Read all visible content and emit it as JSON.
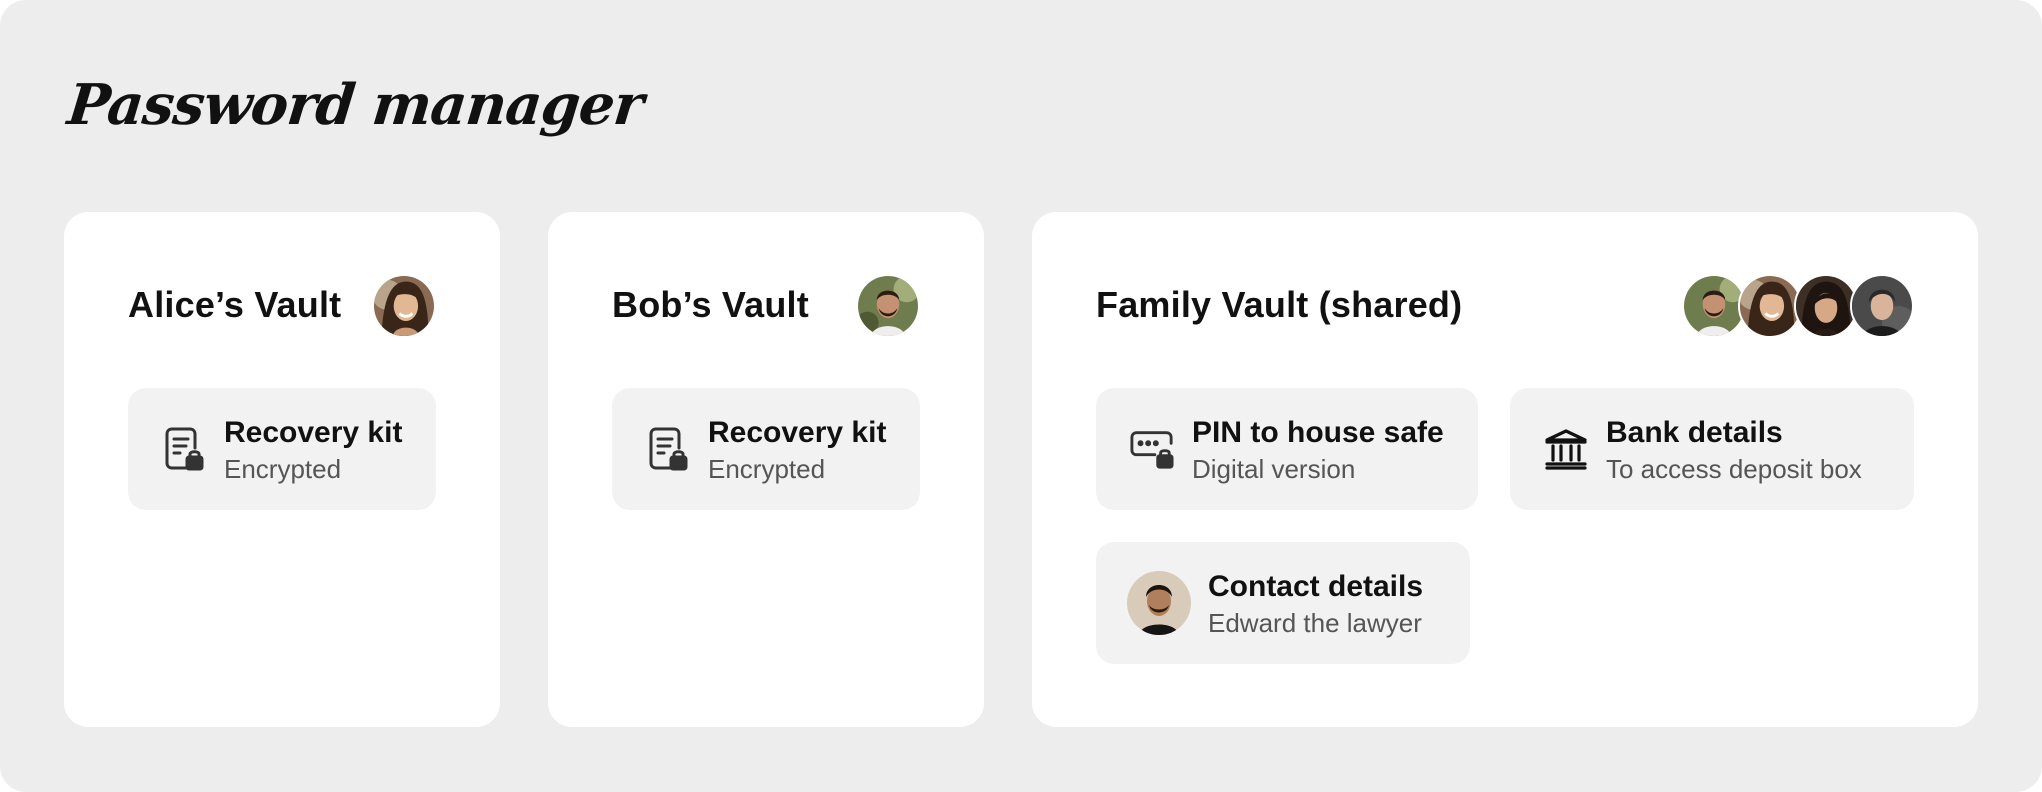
{
  "app": {
    "title": "Password manager"
  },
  "vaults": [
    {
      "name": "Alice’s Vault",
      "members": [
        "alice"
      ],
      "items": [
        {
          "title": "Recovery kit",
          "subtitle": "Encrypted",
          "icon": "document-lock-icon"
        }
      ]
    },
    {
      "name": "Bob’s Vault",
      "members": [
        "bob"
      ],
      "items": [
        {
          "title": "Recovery kit",
          "subtitle": "Encrypted",
          "icon": "document-lock-icon"
        }
      ]
    },
    {
      "name": "Family Vault (shared)",
      "members": [
        "bob",
        "alice",
        "member-3",
        "member-4"
      ],
      "items": [
        {
          "title": "PIN to house safe",
          "subtitle": "Digital version",
          "icon": "password-lock-icon"
        },
        {
          "title": "Bank details",
          "subtitle": "To access deposit box",
          "icon": "bank-icon"
        },
        {
          "title": "Contact details",
          "subtitle": "Edward the lawyer",
          "icon": "contact-photo"
        }
      ]
    }
  ],
  "colors": {
    "background": "#ededed",
    "card": "#ffffff",
    "item": "#f2f2f2",
    "text": "#111111",
    "subtext": "#555555"
  }
}
